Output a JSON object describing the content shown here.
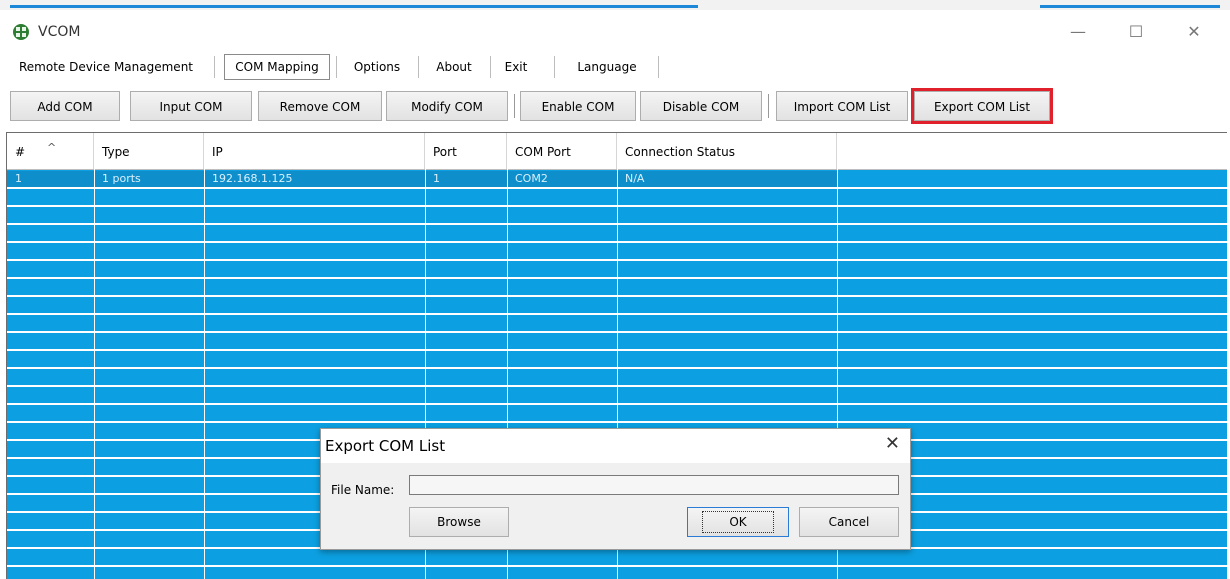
{
  "window": {
    "title": "VCOM",
    "minimize_glyph": "—",
    "maximize_glyph": "☐",
    "close_glyph": "✕"
  },
  "menu": {
    "items": [
      {
        "label": "Remote Device Management"
      },
      {
        "label": "COM Mapping",
        "active": true
      },
      {
        "label": "Options"
      },
      {
        "label": "About"
      },
      {
        "label": "Exit"
      },
      {
        "label": "Language"
      }
    ]
  },
  "toolbar": {
    "buttons": [
      {
        "label": "Add COM"
      },
      {
        "label": "Input COM"
      },
      {
        "label": "Remove COM"
      },
      {
        "label": "Modify COM"
      },
      {
        "label": "Enable COM"
      },
      {
        "label": "Disable COM"
      },
      {
        "label": "Import COM List"
      },
      {
        "label": "Export COM List",
        "highlighted": true
      }
    ],
    "highlight_color": "#e0202a"
  },
  "grid": {
    "columns": [
      "#",
      "Type",
      "IP",
      "Port",
      "COM Port",
      "Connection Status"
    ],
    "sort_indicator": "^",
    "rows": [
      [
        "1",
        "1 ports",
        "192.168.1.125",
        "1",
        "COM2",
        "N/A"
      ]
    ],
    "background_color": "#0ca0e2"
  },
  "dialog": {
    "title": "Export COM List",
    "close_glyph": "✕",
    "file_name_label": "File Name:",
    "file_name_value": "",
    "browse_label": "Browse",
    "ok_label": "OK",
    "cancel_label": "Cancel"
  }
}
